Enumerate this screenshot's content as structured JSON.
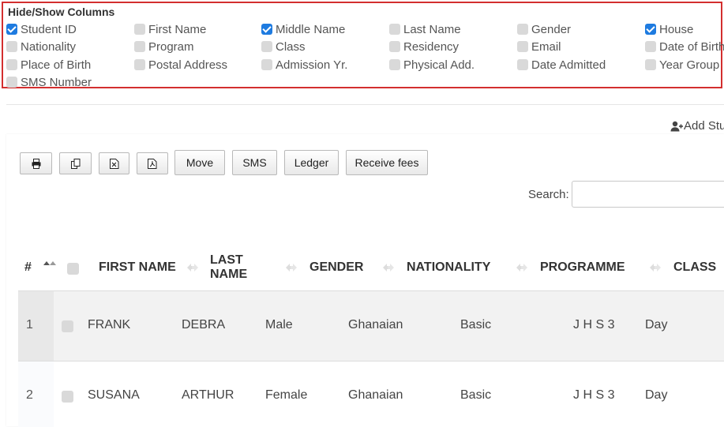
{
  "columns_panel": {
    "title": "Hide/Show Columns",
    "items": [
      {
        "label": "Student ID",
        "checked": true
      },
      {
        "label": "First Name",
        "checked": false
      },
      {
        "label": "Middle Name",
        "checked": true
      },
      {
        "label": "Last Name",
        "checked": false
      },
      {
        "label": "Gender",
        "checked": false
      },
      {
        "label": "House",
        "checked": true
      },
      {
        "label": "Nationality",
        "checked": false
      },
      {
        "label": "Program",
        "checked": false
      },
      {
        "label": "Class",
        "checked": false
      },
      {
        "label": "Residency",
        "checked": false
      },
      {
        "label": "Email",
        "checked": false
      },
      {
        "label": "Date of Birth",
        "checked": false
      },
      {
        "label": "Place of Birth",
        "checked": false
      },
      {
        "label": "Postal Address",
        "checked": false
      },
      {
        "label": "Admission Yr.",
        "checked": false
      },
      {
        "label": "Physical Add.",
        "checked": false
      },
      {
        "label": "Date Admitted",
        "checked": false
      },
      {
        "label": "Year Group",
        "checked": false
      },
      {
        "label": "SMS Number",
        "checked": false
      }
    ]
  },
  "add_student_label": "Add Stu",
  "toolbar": {
    "icon_buttons": [
      {
        "icon": "print-icon"
      },
      {
        "icon": "copy-icon"
      },
      {
        "icon": "excel-icon"
      },
      {
        "icon": "pdf-icon"
      }
    ],
    "move_label": "Move",
    "sms_label": "SMS",
    "ledger_label": "Ledger",
    "receive_fees_label": "Receive fees"
  },
  "search": {
    "label": "Search:",
    "value": ""
  },
  "table": {
    "headers": {
      "index": "#",
      "first_name": "FIRST NAME",
      "last_name_line1": "LAST",
      "last_name_line2": "NAME",
      "gender": "GENDER",
      "nationality": "NATIONALITY",
      "programme": "PROGRAMME",
      "class": "CLASS"
    },
    "rows": [
      {
        "index": "1",
        "first_name": "FRANK",
        "last_name": "DEBRA",
        "gender": "Male",
        "nationality": "Ghanaian",
        "programme": "Basic",
        "class": "J H S 3",
        "residency": "Day"
      },
      {
        "index": "2",
        "first_name": "SUSANA",
        "last_name": "ARTHUR",
        "gender": "Female",
        "nationality": "Ghanaian",
        "programme": "Basic",
        "class": "J H S 3",
        "residency": "Day"
      }
    ]
  },
  "colors": {
    "accent": "#1e7be0",
    "panel_border": "#d32f2f"
  }
}
